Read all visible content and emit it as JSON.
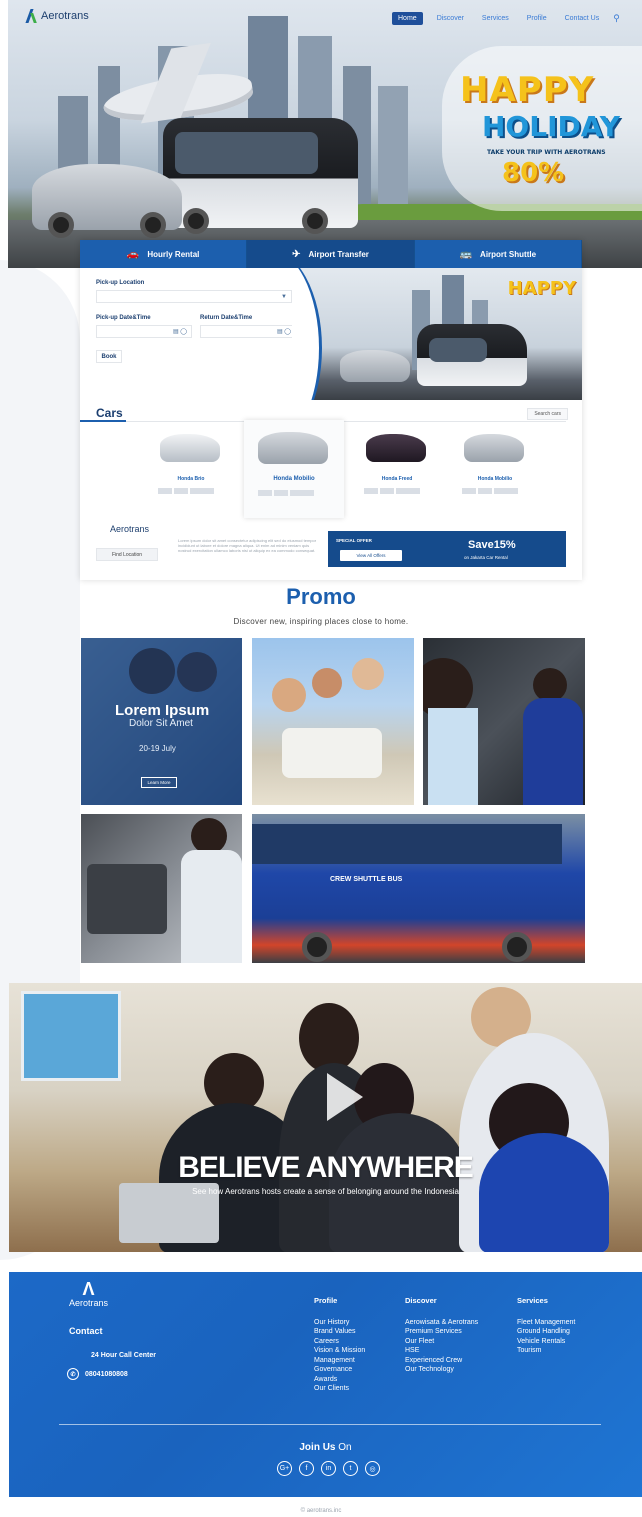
{
  "brand": {
    "name": "Aerotrans"
  },
  "nav": {
    "items": [
      "Home",
      "Discover",
      "Services",
      "Profile",
      "Contact Us"
    ],
    "active": "Home",
    "search_icon": "search-icon"
  },
  "hero": {
    "happy": "HAPPY",
    "holiday": "HOLIDAY",
    "tagline": "TAKE YOUR TRIP WITH AEROTRANS",
    "discount": "80%"
  },
  "booking": {
    "tabs": [
      {
        "label": "Hourly Rental",
        "icon": "car-icon"
      },
      {
        "label": "Airport Transfer",
        "icon": "plane-icon"
      },
      {
        "label": "Airport Shuttle",
        "icon": "bus-icon"
      }
    ],
    "pickup_location_label": "Pick-up Location",
    "pickup_datetime_label": "Pick-up Date&Time",
    "return_datetime_label": "Return Date&Time",
    "book_label": "Book",
    "panel_happy": "HAPPY"
  },
  "cars": {
    "title": "Cars",
    "search_label": "Search cars",
    "items": [
      {
        "name": "Honda Brio",
        "color": "#e3e6ea"
      },
      {
        "name": "Honda Mobilio",
        "color": "#c9ced5"
      },
      {
        "name": "Honda Freed",
        "color": "#2a1f2c"
      },
      {
        "name": "Honda Mobilio",
        "color": "#d2d6dc"
      }
    ],
    "find_location": "Find Location",
    "small_text": "Lorem ipsum dolor sit amet consectetur adipiscing elit sed do eiusmod tempor incididunt ut labore et dolore magna aliqua. Ut enim ad minim veniam quis nostrud exercitation ullamco laboris nisi ut aliquip ex ea commodo consequat."
  },
  "special": {
    "label": "SPECIAL OFFER",
    "button": "View All Offers",
    "save": "Save15%",
    "sub": "on Jakarta Car Rental"
  },
  "promo": {
    "title": "Promo",
    "subtitle": "Discover new, inspiring places close to home.",
    "featured": {
      "title": "Lorem Ipsum",
      "subtitle": "Dolor Sit Amet",
      "date": "20-19 July",
      "button": "Learn More"
    },
    "bus_text": "CREW SHUTTLE BUS"
  },
  "video": {
    "title": "BELIEVE ANYWHERE",
    "subtitle": "See how Aerotrans hosts create a sense of belonging around the Indonesia"
  },
  "footer": {
    "contact_title": "Contact",
    "call_center": "24 Hour Call Center",
    "phone": "08041080808",
    "columns": [
      {
        "title": "Profile",
        "items": [
          "Our History",
          "Brand Values",
          "Careers",
          "Vision & Mission",
          "Management",
          "Governance",
          "Awards",
          "Our Clients"
        ]
      },
      {
        "title": "Discover",
        "items": [
          "Aerowisata & Aerotrans",
          "Premium Services",
          "Our Fleet",
          "HSE",
          "Experienced Crew",
          "Our Technology"
        ]
      },
      {
        "title": "Services",
        "items": [
          "Fleet Management",
          "Ground Handling",
          "Vehicle Rentals",
          "Tourism"
        ]
      }
    ],
    "join_bold": "Join Us",
    "join_rest": "On",
    "socials": [
      "google-plus-icon",
      "facebook-icon",
      "linkedin-icon",
      "twitter-icon",
      "instagram-icon"
    ],
    "social_glyphs": [
      "G+",
      "f",
      "in",
      "t",
      "◎"
    ]
  },
  "copyright": "© aerotrans.inc"
}
